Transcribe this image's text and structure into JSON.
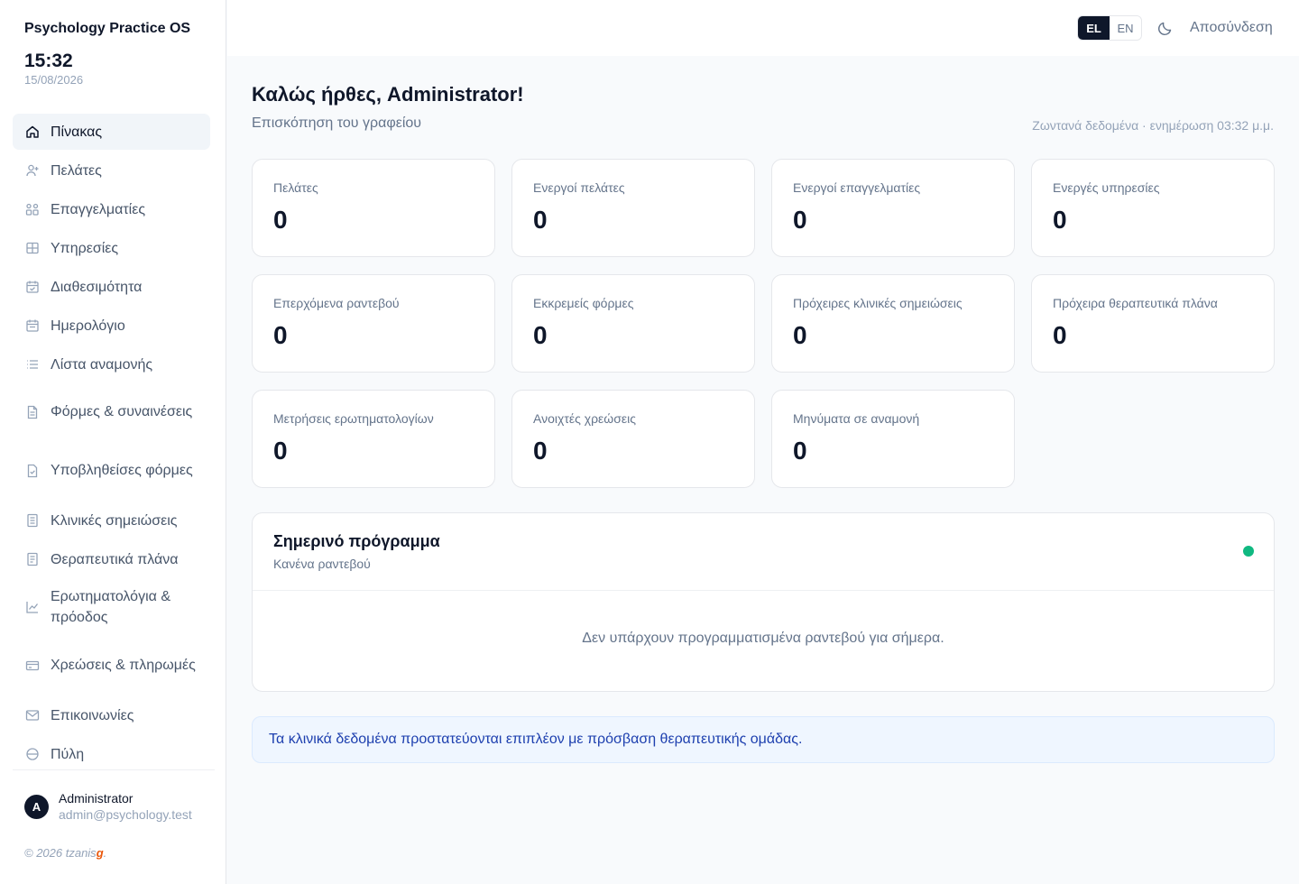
{
  "app": {
    "title": "Psychology Practice OS",
    "time": "15:32",
    "date": "15/08/2026"
  },
  "sidebar": {
    "items": [
      {
        "label": "Πίνακας",
        "icon": "home-icon",
        "active": true
      },
      {
        "label": "Πελάτες",
        "icon": "user-icon"
      },
      {
        "label": "Επαγγελματίες",
        "icon": "users-icon"
      },
      {
        "label": "Υπηρεσίες",
        "icon": "grid-icon"
      },
      {
        "label": "Διαθεσιμότητα",
        "icon": "calendar-check-icon"
      },
      {
        "label": "Ημερολόγιο",
        "icon": "calendar-icon"
      },
      {
        "label": "Λίστα αναμονής",
        "icon": "list-icon"
      },
      {
        "label": "Φόρμες & συναινέσεις",
        "icon": "document-icon"
      },
      {
        "label": "Υποβληθείσες φόρμες",
        "icon": "file-check-icon"
      },
      {
        "label": "Κλινικές σημειώσεις",
        "icon": "notes-icon"
      },
      {
        "label": "Θεραπευτικά πλάνα",
        "icon": "clipboard-icon"
      },
      {
        "label": "Ερωτηματολόγια & πρόοδος",
        "icon": "chart-line-icon"
      },
      {
        "label": "Χρεώσεις & πληρωμές",
        "icon": "credit-card-icon"
      },
      {
        "label": "Επικοινωνίες",
        "icon": "mail-icon"
      },
      {
        "label": "Πύλη",
        "icon": "portal-icon"
      }
    ]
  },
  "user": {
    "initial": "A",
    "name": "Administrator",
    "email": "admin@psychology.test"
  },
  "footer": {
    "copyright_prefix": "© 2026 tzanis",
    "copyright_mark": "g",
    "copyright_suffix": "."
  },
  "topbar": {
    "lang_el": "EL",
    "lang_en": "EN",
    "active_lang": "EL",
    "theme_icon": "moon-icon",
    "logout": "Αποσύνδεση"
  },
  "header": {
    "welcome": "Καλώς ήρθες, Administrator!",
    "subtitle": "Επισκόπηση του γραφείου",
    "live_status": "Ζωντανά δεδομένα · ενημέρωση 03:32 μ.μ."
  },
  "stats": [
    {
      "label": "Πελάτες",
      "value": "0"
    },
    {
      "label": "Ενεργοί πελάτες",
      "value": "0"
    },
    {
      "label": "Ενεργοί επαγγελματίες",
      "value": "0"
    },
    {
      "label": "Ενεργές υπηρεσίες",
      "value": "0"
    },
    {
      "label": "Επερχόμενα ραντεβού",
      "value": "0"
    },
    {
      "label": "Εκκρεμείς φόρμες",
      "value": "0"
    },
    {
      "label": "Πρόχειρες κλινικές σημειώσεις",
      "value": "0"
    },
    {
      "label": "Πρόχειρα θεραπευτικά πλάνα",
      "value": "0"
    },
    {
      "label": "Μετρήσεις ερωτηματολογίων",
      "value": "0"
    },
    {
      "label": "Ανοιχτές χρεώσεις",
      "value": "0"
    },
    {
      "label": "Μηνύματα σε αναμονή",
      "value": "0"
    }
  ],
  "schedule": {
    "title": "Σημερινό πρόγραμμα",
    "subtitle": "Κανένα ραντεβού",
    "empty": "Δεν υπάρχουν προγραμματισμένα ραντεβού για σήμερα.",
    "status_color": "#10b981"
  },
  "notice": {
    "text": "Τα κλινικά δεδομένα προστατεύονται επιπλέον με πρόσβαση θεραπευτικής ομάδας."
  },
  "colors": {
    "accent_dark": "#0f172a",
    "notice_bg": "#eff6ff",
    "notice_text": "#1e40af",
    "live_dot": "#10b981"
  }
}
